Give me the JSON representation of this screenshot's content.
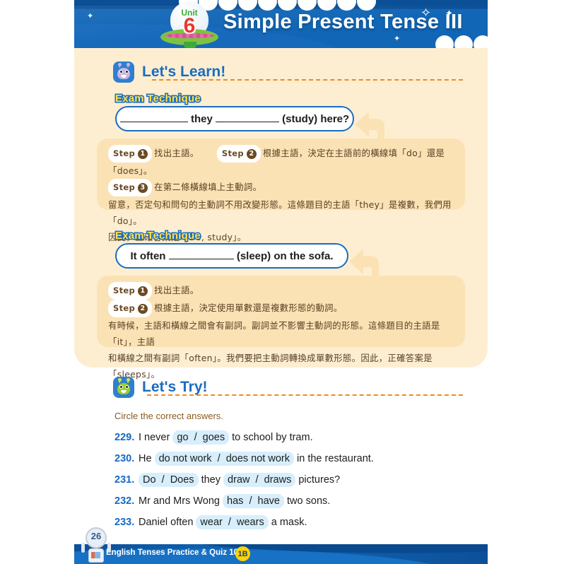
{
  "header": {
    "unit_label": "Unit",
    "unit_number": "6",
    "title": "Simple Present Tense III"
  },
  "lets_learn": {
    "icon": "monster-icon",
    "title": "Let's Learn!",
    "items": [
      {
        "exam_label": "Exam Technique",
        "question_pre": "",
        "question_mid": "they",
        "question_post": "(study) here?",
        "steps": [
          {
            "chip": "Step",
            "num": "1",
            "text": "找出主語。"
          },
          {
            "chip": "Step",
            "num": "2",
            "text": "根據主語，決定在主語前的橫線填「do」還是「does」。"
          },
          {
            "chip": "Step",
            "num": "3",
            "text": "在第二條橫線填上主動詞。"
          }
        ],
        "note_line1": "留意，否定句和問句的主動詞不用改變形態。這條題目的主語「they」是複數，我們用「do」。",
        "note_line2": "因此，正確答案是「Do, study」。"
      },
      {
        "exam_label": "Exam Technique",
        "question_pre": "It often",
        "question_post": "(sleep) on the sofa.",
        "steps": [
          {
            "chip": "Step",
            "num": "1",
            "text": "找出主語。"
          },
          {
            "chip": "Step",
            "num": "2",
            "text": "根據主語，決定使用單數還是複數形態的動詞。"
          }
        ],
        "note_line1": "有時候，主語和橫線之間會有副詞。副詞並不影響主動詞的形態。這條題目的主語是「it」，主語",
        "note_line2": "和橫線之間有副詞「often」。我們要把主動詞轉換成單數形態。因此，正確答案是「sleeps」。"
      }
    ]
  },
  "lets_try": {
    "icon": "frog-icon",
    "title": "Let's Try!",
    "instruction": "Circle the correct answers.",
    "questions": [
      {
        "num": "229.",
        "before": "I never",
        "choice_a": "go",
        "sep": "/",
        "choice_b": "goes",
        "after": "to school by tram."
      },
      {
        "num": "230.",
        "before": "He",
        "choice_a": "do not work",
        "sep": "/",
        "choice_b": "does not work",
        "after": "in the restaurant."
      },
      {
        "num": "231.",
        "before": "",
        "choice_a": "Do",
        "sep": "/",
        "choice_b": "Does",
        "mid": "they",
        "choice_c": "draw",
        "sep2": "/",
        "choice_d": "draws",
        "after": "pictures?"
      },
      {
        "num": "232.",
        "before": "Mr and Mrs Wong",
        "choice_a": "has",
        "sep": "/",
        "choice_b": "have",
        "after": "two sons."
      },
      {
        "num": "233.",
        "before": "Daniel often",
        "choice_a": "wear",
        "sep": "/",
        "choice_b": "wears",
        "after": "a mask."
      }
    ]
  },
  "footer": {
    "page_number": "26",
    "book_title": "English Tenses Practice & Quiz 1000",
    "level_badge": "1B"
  },
  "colors": {
    "header_blue": "#0d5cab",
    "cream": "#fdeed1",
    "step_panel": "#fbe2b4",
    "accent_orange": "#ef8a21",
    "title_blue": "#1a6cc0",
    "highlight_blue": "#d7eefc",
    "badge_yellow": "#ffd400"
  }
}
